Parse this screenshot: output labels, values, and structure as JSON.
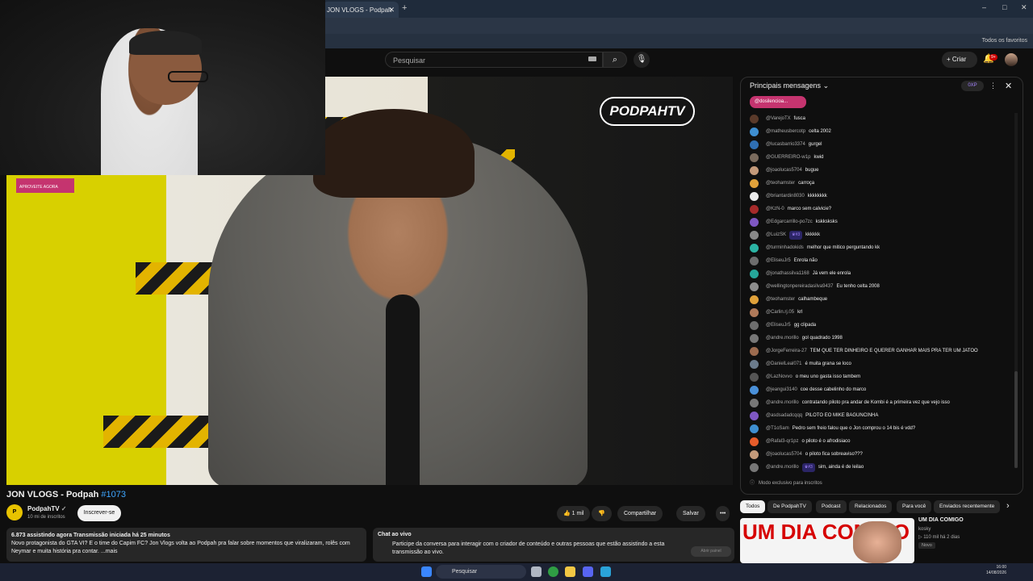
{
  "browser": {
    "tab_title": "JON VLOGS - Podpah",
    "tab_close": "✕",
    "new_tab": "+",
    "bookmarks_label": "Todos os favoritos",
    "win_min": "–",
    "win_max": "□",
    "win_close": "✕"
  },
  "header": {
    "search_placeholder": "Pesquisar",
    "search_icon": "⌕",
    "mic_icon": "🎙",
    "create_label": "+ Criar",
    "notification_badge": "9+",
    "bell_icon": "🔔"
  },
  "video": {
    "logo_text": "PODPAHTV",
    "promo_text": "APROVEITE AGORA"
  },
  "info": {
    "title": "JON VLOGS - Podpah",
    "hashtag": "#1073",
    "channel_name": "PodpahTV",
    "channel_verified": "✓",
    "subscribers": "10 mi de inscritos",
    "subscribe_label": "Inscrever-se",
    "like_label": "👍 1 mil",
    "dislike_icon": "👎",
    "share_label": "Compartilhar",
    "save_label": "Salvar",
    "more_icon": "•••",
    "stats_line": "6.873 assistindo agora  Transmissão iniciada há 25 minutos",
    "desc_line1": "Novo protagonista do GTA VI? E o time do Capim FC? Jon Vlogs volta ao Podpah pra falar sobre momentos que viralizaram, rolês com",
    "desc_line2": "Neymar e muita história pra contar.  ...mais"
  },
  "live_chat_card": {
    "title": "Chat ao vivo",
    "body": "Participe da conversa para interagir com o criador de conteúdo e outras pessoas que estão assistindo a esta transmissão ao vivo.",
    "button": "Abrir painel"
  },
  "chat": {
    "header": "Principais mensagens",
    "chevron": "⌄",
    "xp": "0XP",
    "dots": "⋮",
    "close": "✕",
    "pinned": "@dosilencioa...",
    "footer": "Modo exclusivo para inscritos",
    "messages": [
      {
        "author": "@VarejoTX",
        "text": "fusca",
        "color": "#5a3a2a"
      },
      {
        "author": "@matheusbercotp",
        "text": "celta 2002",
        "color": "#3e8ed0"
      },
      {
        "author": "@lucasbarrio3374",
        "text": "gurgel",
        "color": "#2f6fb3"
      },
      {
        "author": "@GUERREIRO-w1p",
        "text": "kwid",
        "color": "#7a6b5d"
      },
      {
        "author": "@joaolucas5704",
        "text": "bugue",
        "color": "#c49a7a"
      },
      {
        "author": "@teohamster",
        "text": "carroça",
        "color": "#e0a13a"
      },
      {
        "author": "@briantardin8030",
        "text": "kkkkkkkk",
        "color": "#eaeaea"
      },
      {
        "author": "@KzN-0",
        "text": "marco sem calvicie?",
        "color": "#a52a2a"
      },
      {
        "author": "@Edgarcarrillo-po7zc",
        "text": "kskksksks",
        "color": "#7e57c2"
      },
      {
        "author": "@LuizSK",
        "badge": "♛#3",
        "text": "kkkkkk",
        "color": "#888888"
      },
      {
        "author": "@turminhadokids",
        "text": "melhor que mitico perguntando kk",
        "color": "#2bb3a3"
      },
      {
        "author": "@EliseuJr5",
        "text": "Enrola não",
        "color": "#6d6d6d"
      },
      {
        "author": "@jonathassilva1168",
        "text": "Já vem ele enrola",
        "color": "#26a69a"
      },
      {
        "author": "@wellingtonpereiradasilva9437",
        "text": "Eu tenho celta 2008",
        "color": "#8d8d8d"
      },
      {
        "author": "@teohamster",
        "text": "calhambeque",
        "color": "#e0a13a"
      },
      {
        "author": "@Carlin.rj.05",
        "text": "krl",
        "color": "#b07a5a"
      },
      {
        "author": "@EliseuJr5",
        "text": "gg clipada",
        "color": "#6d6d6d"
      },
      {
        "author": "@andre.morillo",
        "text": "gol quadrado 1998",
        "color": "#777777"
      },
      {
        "author": "@JorgeFerreira-27",
        "text": "TEM QUE TER DINHEIRO E QUERER GANHAR MAIS PRA TER UM JATOO",
        "color": "#9c6b4f"
      },
      {
        "author": "@DanielLeal071",
        "text": "é muita grana se loco",
        "color": "#6b7b8c"
      },
      {
        "author": "@LazNovvo",
        "text": "o meu uno gasta isso tambem",
        "color": "#555555"
      },
      {
        "author": "@jeangui3140",
        "text": "coe desse cabelinho do marco",
        "color": "#4a90d9"
      },
      {
        "author": "@andre.morillo",
        "text": "contratando piloto pra andar de Kombi é a primeira vez que vejo isso",
        "color": "#777777"
      },
      {
        "author": "@asdsadadcqqq",
        "text": "PILOTO EO MIKE BAGUNCINHA",
        "color": "#7e57c2"
      },
      {
        "author": "@T1oSam",
        "text": "Pedro sem freio falou que o Jon comprou o 14 bis é vdd?",
        "color": "#3e8ed0"
      },
      {
        "author": "@Rafal3-qr1pz",
        "text": "o piloto é o afrodisiaco",
        "color": "#e65c2a"
      },
      {
        "author": "@joaolucas5704",
        "text": "o piloto fica sobreaviso???",
        "color": "#c49a7a"
      },
      {
        "author": "@andre.morillo",
        "badge": "♛#3",
        "text": "sim, ainda é de leilao",
        "color": "#777777"
      }
    ]
  },
  "chips": [
    "Todos",
    "De PodpahTV",
    "Podcast",
    "Relacionados",
    "Para você",
    "Enviados recentemente"
  ],
  "chips_next": "›",
  "recommended": {
    "thumb_text": "UM DIA COMIGO",
    "title": "UM DIA COMIGO",
    "channel": "kosky",
    "meta": "▷ 110 mil  há 2 dias",
    "badge": "Novo"
  },
  "taskbar": {
    "search": "Pesquisar",
    "time": "16:00",
    "date": "14/08/2026"
  }
}
